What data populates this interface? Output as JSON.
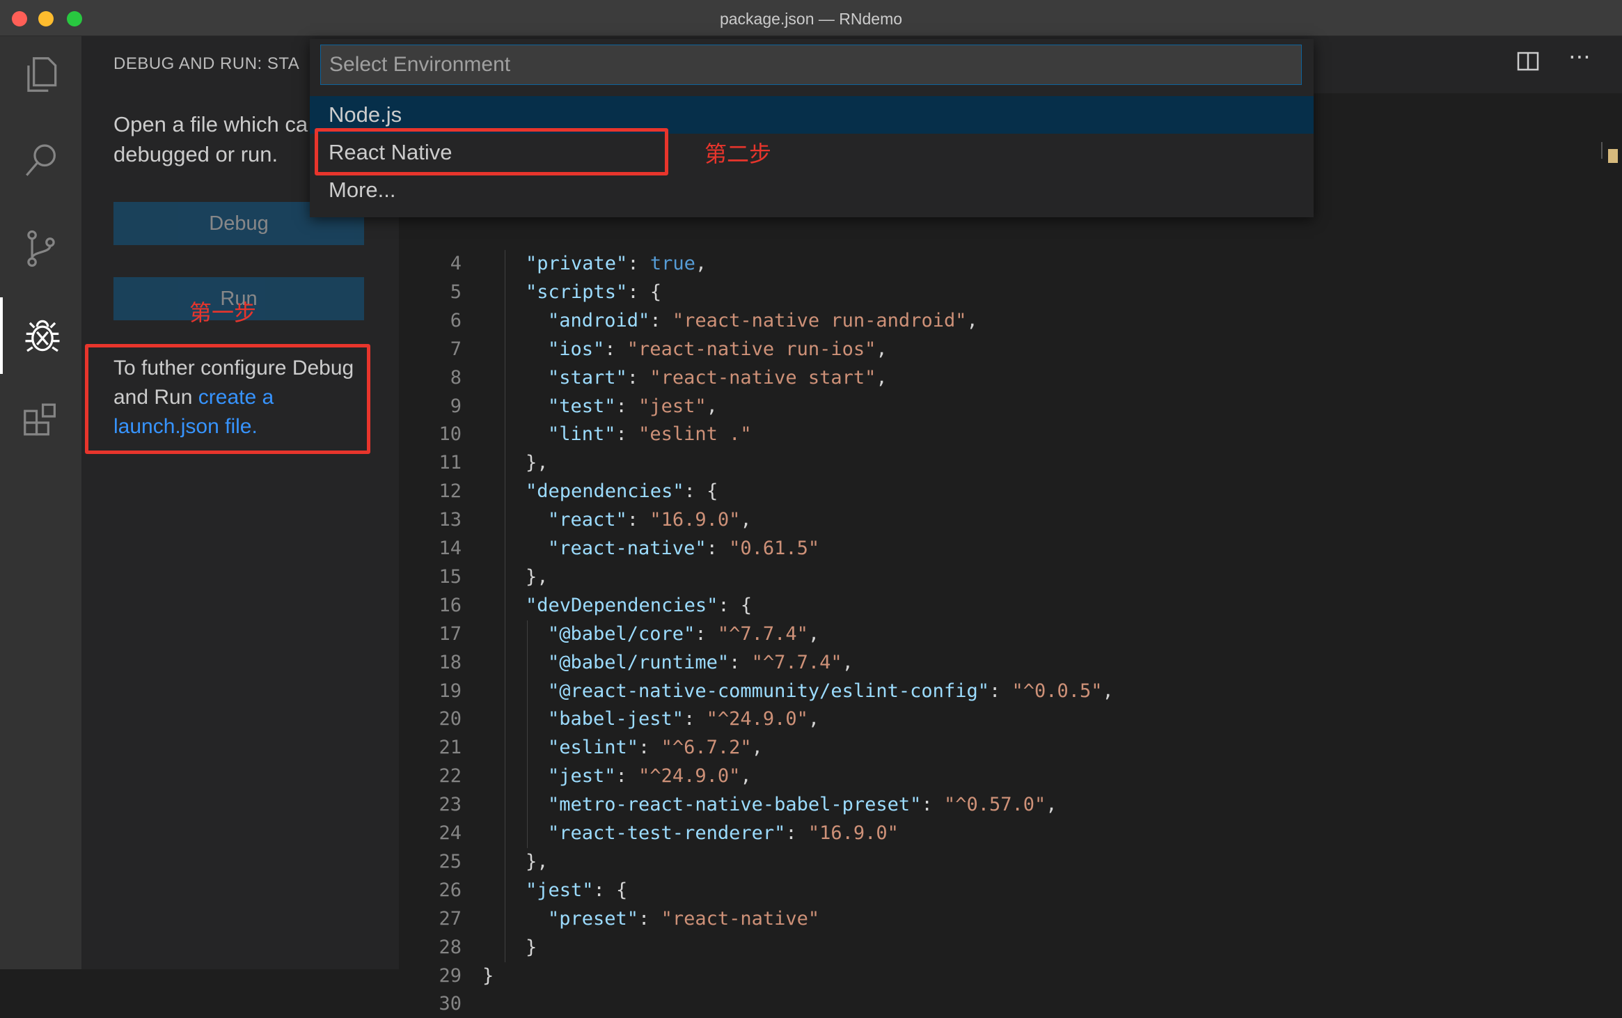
{
  "window": {
    "title": "package.json — RNdemo"
  },
  "activity_bar": {
    "items": [
      {
        "name": "explorer",
        "icon": "files-icon"
      },
      {
        "name": "search",
        "icon": "search-icon"
      },
      {
        "name": "source-control",
        "icon": "source-control-icon"
      },
      {
        "name": "debug",
        "icon": "bug-icon",
        "active": true
      },
      {
        "name": "extensions",
        "icon": "extensions-icon"
      }
    ]
  },
  "sidebar": {
    "header": "DEBUG AND RUN: STA",
    "intro_line1": "Open a file which ca",
    "intro_line2": "debugged or run.",
    "debug_label": "Debug",
    "run_label": "Run",
    "config_text": "To futher configure Debug and Run ",
    "config_link": "create a launch.json file."
  },
  "annotations": {
    "step1": "第一步",
    "step2": "第二步",
    "color": "#e8352c"
  },
  "quick_pick": {
    "placeholder": "Select Environment",
    "items": [
      "Node.js",
      "React Native",
      "More..."
    ],
    "selected_index": 0
  },
  "editor": {
    "lines": [
      {
        "n": "4",
        "indent": 1,
        "tokens": [
          [
            "k",
            "\"private\""
          ],
          [
            "p",
            ": "
          ],
          [
            "b",
            "true"
          ],
          [
            "p",
            ","
          ]
        ]
      },
      {
        "n": "5",
        "indent": 1,
        "tokens": [
          [
            "k",
            "\"scripts\""
          ],
          [
            "p",
            ": {"
          ]
        ]
      },
      {
        "n": "6",
        "indent": 2,
        "tokens": [
          [
            "k",
            "\"android\""
          ],
          [
            "p",
            ": "
          ],
          [
            "s",
            "\"react-native run-android\""
          ],
          [
            "p",
            ","
          ]
        ]
      },
      {
        "n": "7",
        "indent": 2,
        "tokens": [
          [
            "k",
            "\"ios\""
          ],
          [
            "p",
            ": "
          ],
          [
            "s",
            "\"react-native run-ios\""
          ],
          [
            "p",
            ","
          ]
        ]
      },
      {
        "n": "8",
        "indent": 2,
        "tokens": [
          [
            "k",
            "\"start\""
          ],
          [
            "p",
            ": "
          ],
          [
            "s",
            "\"react-native start\""
          ],
          [
            "p",
            ","
          ]
        ]
      },
      {
        "n": "9",
        "indent": 2,
        "tokens": [
          [
            "k",
            "\"test\""
          ],
          [
            "p",
            ": "
          ],
          [
            "s",
            "\"jest\""
          ],
          [
            "p",
            ","
          ]
        ]
      },
      {
        "n": "10",
        "indent": 2,
        "tokens": [
          [
            "k",
            "\"lint\""
          ],
          [
            "p",
            ": "
          ],
          [
            "s",
            "\"eslint .\""
          ]
        ]
      },
      {
        "n": "11",
        "indent": 1,
        "tokens": [
          [
            "p",
            "},"
          ]
        ]
      },
      {
        "n": "12",
        "indent": 1,
        "tokens": [
          [
            "k",
            "\"dependencies\""
          ],
          [
            "p",
            ": {"
          ]
        ]
      },
      {
        "n": "13",
        "indent": 2,
        "tokens": [
          [
            "k",
            "\"react\""
          ],
          [
            "p",
            ": "
          ],
          [
            "s",
            "\"16.9.0\""
          ],
          [
            "p",
            ","
          ]
        ]
      },
      {
        "n": "14",
        "indent": 2,
        "tokens": [
          [
            "k",
            "\"react-native\""
          ],
          [
            "p",
            ": "
          ],
          [
            "s",
            "\"0.61.5\""
          ]
        ]
      },
      {
        "n": "15",
        "indent": 1,
        "tokens": [
          [
            "p",
            "},"
          ]
        ]
      },
      {
        "n": "16",
        "indent": 1,
        "tokens": [
          [
            "k",
            "\"devDependencies\""
          ],
          [
            "p",
            ": {"
          ]
        ]
      },
      {
        "n": "17",
        "indent": 2,
        "tokens": [
          [
            "k",
            "\"@babel/core\""
          ],
          [
            "p",
            ": "
          ],
          [
            "s",
            "\"^7.7.4\""
          ],
          [
            "p",
            ","
          ]
        ]
      },
      {
        "n": "18",
        "indent": 2,
        "tokens": [
          [
            "k",
            "\"@babel/runtime\""
          ],
          [
            "p",
            ": "
          ],
          [
            "s",
            "\"^7.7.4\""
          ],
          [
            "p",
            ","
          ]
        ]
      },
      {
        "n": "19",
        "indent": 2,
        "tokens": [
          [
            "k",
            "\"@react-native-community/eslint-config\""
          ],
          [
            "p",
            ": "
          ],
          [
            "s",
            "\"^0.0.5\""
          ],
          [
            "p",
            ","
          ]
        ]
      },
      {
        "n": "20",
        "indent": 2,
        "tokens": [
          [
            "k",
            "\"babel-jest\""
          ],
          [
            "p",
            ": "
          ],
          [
            "s",
            "\"^24.9.0\""
          ],
          [
            "p",
            ","
          ]
        ]
      },
      {
        "n": "21",
        "indent": 2,
        "tokens": [
          [
            "k",
            "\"eslint\""
          ],
          [
            "p",
            ": "
          ],
          [
            "s",
            "\"^6.7.2\""
          ],
          [
            "p",
            ","
          ]
        ]
      },
      {
        "n": "22",
        "indent": 2,
        "tokens": [
          [
            "k",
            "\"jest\""
          ],
          [
            "p",
            ": "
          ],
          [
            "s",
            "\"^24.9.0\""
          ],
          [
            "p",
            ","
          ]
        ]
      },
      {
        "n": "23",
        "indent": 2,
        "tokens": [
          [
            "k",
            "\"metro-react-native-babel-preset\""
          ],
          [
            "p",
            ": "
          ],
          [
            "s",
            "\"^0.57.0\""
          ],
          [
            "p",
            ","
          ]
        ]
      },
      {
        "n": "24",
        "indent": 2,
        "tokens": [
          [
            "k",
            "\"react-test-renderer\""
          ],
          [
            "p",
            ": "
          ],
          [
            "s",
            "\"16.9.0\""
          ]
        ]
      },
      {
        "n": "25",
        "indent": 1,
        "tokens": [
          [
            "p",
            "},"
          ]
        ]
      },
      {
        "n": "26",
        "indent": 1,
        "tokens": [
          [
            "k",
            "\"jest\""
          ],
          [
            "p",
            ": {"
          ]
        ]
      },
      {
        "n": "27",
        "indent": 2,
        "tokens": [
          [
            "k",
            "\"preset\""
          ],
          [
            "p",
            ": "
          ],
          [
            "s",
            "\"react-native\""
          ]
        ]
      },
      {
        "n": "28",
        "indent": 1,
        "tokens": [
          [
            "p",
            "}"
          ]
        ]
      },
      {
        "n": "29",
        "indent": 0,
        "tokens": [
          [
            "p",
            "}"
          ]
        ]
      },
      {
        "n": "30",
        "indent": 0,
        "tokens": []
      }
    ]
  },
  "colors": {
    "key": "#9cdcfe",
    "string": "#ce9178",
    "boolean": "#569cd6",
    "accent": "#0e639c"
  }
}
